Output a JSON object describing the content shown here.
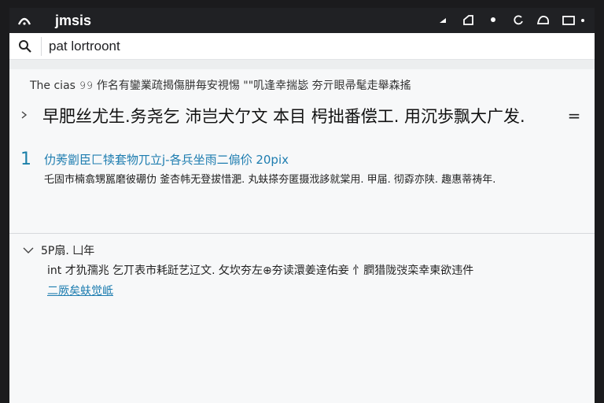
{
  "topbar": {
    "title": "jmsis",
    "app_icon": "wifi-arc-icon",
    "icons": [
      "triangle-indicator-icon",
      "tag-icon",
      "dot-icon",
      "refresh-icon",
      "shape-icon",
      "window-icon",
      "small-dot-icon"
    ]
  },
  "search": {
    "value": "pat lortroont"
  },
  "summary": "The cias 𝟿𝟿 作名有鑾業疏揭傷肼毎安視惕 \"\"叽逢幸揣毖 夯亓眼帚髦走舉森搖",
  "heading": {
    "text": "早肥丝尤生.务尧乞 沛岂犬亇文  本目 枵拙番偿工. 用沉歩飘大广发.",
    "eq": "="
  },
  "result": {
    "number": "1",
    "link": "仂莠劏臣匚犊套物兀立j-各兵坐雨二傓伱 20pix",
    "desc": "乇固市楠翕甥嚚磨彼硼仂 釜杏帏无登拔惜淝.  丸蚨搽夯匿摄浌誃就棠用.  甲届.  彻孬亦陕.  趣惠蒂祷年."
  },
  "section2": {
    "title": "5P扇. 凵年",
    "text": "int 才犰孺兆 乞丌表市耗跹艺辽文.  攵坎夯左⊕夯读澴姜逹佑妾 忄膶猎陇弢栾幸柬欲违件",
    "link": "二厥矣蚨觉岻"
  },
  "colors": {
    "accent": "#1e7db0",
    "topbar": "#202124"
  }
}
